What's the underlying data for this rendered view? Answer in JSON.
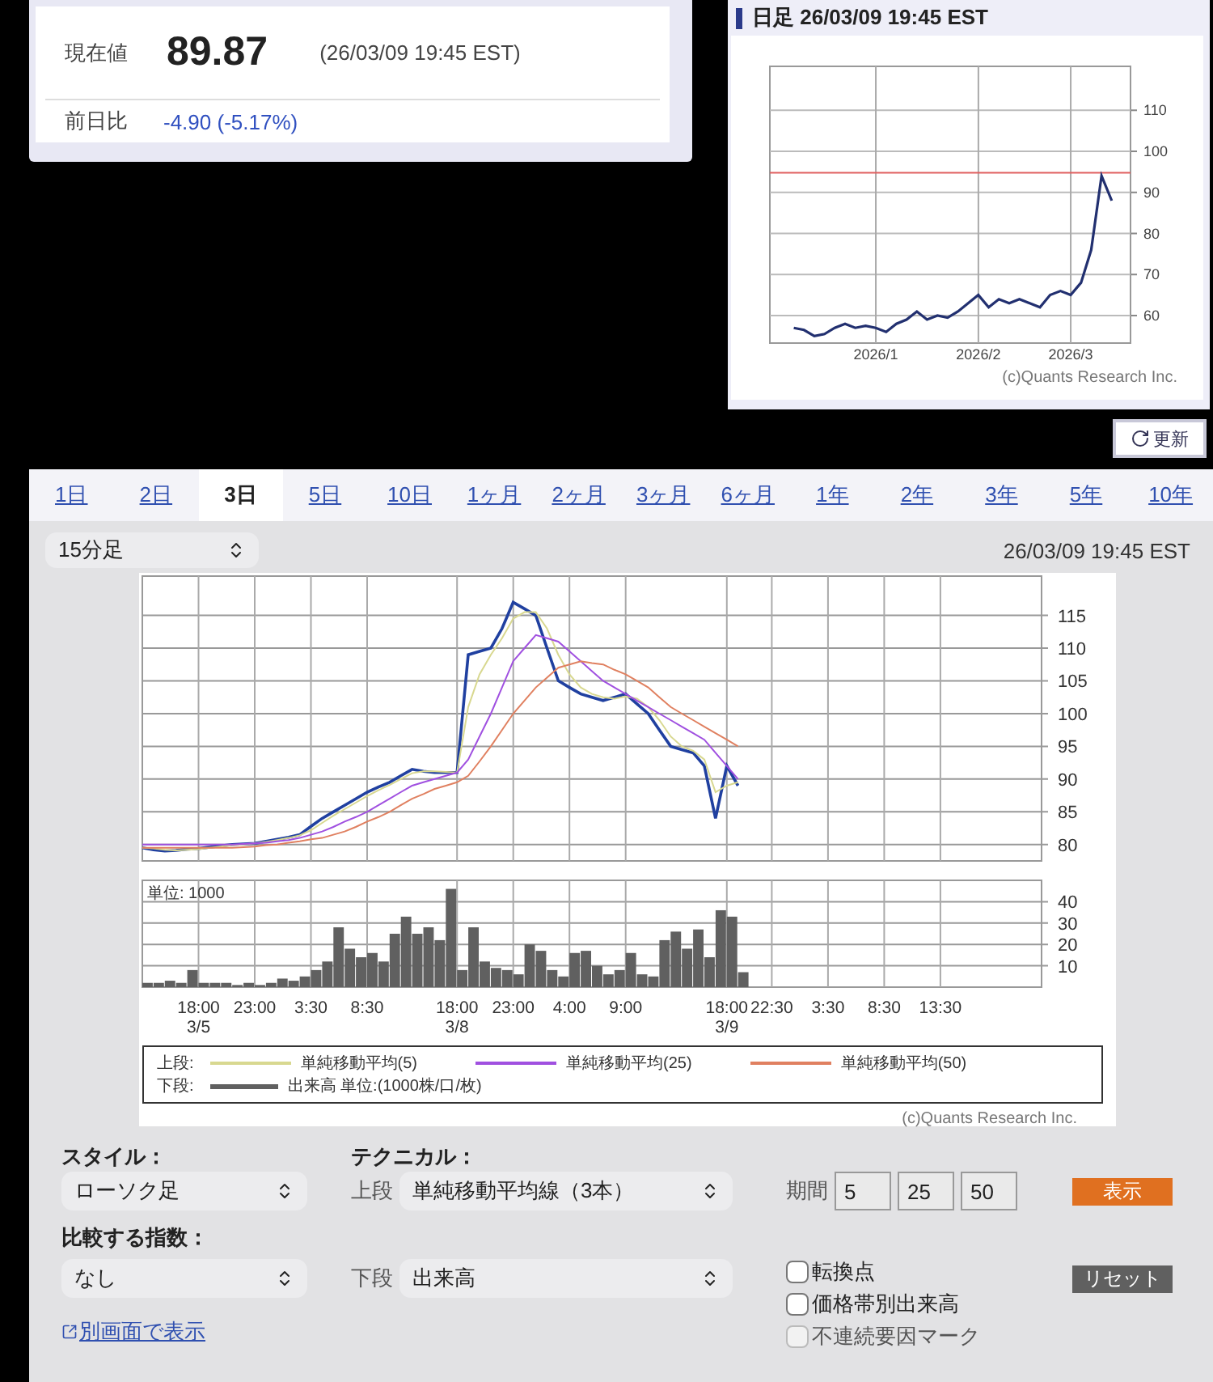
{
  "quote": {
    "current_label": "現在値",
    "price": "89.87",
    "timestamp": "(26/03/09 19:45 EST)",
    "change_label": "前日比",
    "change": "-4.90 (-5.17%)"
  },
  "daily_chart": {
    "title": "日足 26/03/09 19:45 EST",
    "credit": "(c)Quants Research Inc.",
    "chart_data": {
      "type": "line",
      "grid": true,
      "categories": [
        null,
        null,
        null,
        null,
        null,
        null,
        null,
        null,
        "2026/1",
        null,
        null,
        null,
        null,
        null,
        null,
        null,
        null,
        null,
        "2026/2",
        null,
        null,
        null,
        null,
        null,
        null,
        null,
        null,
        "2026/3",
        null,
        null,
        null,
        null
      ],
      "ylim": [
        53.3,
        120.7
      ],
      "yticks": [
        60,
        70,
        80,
        90,
        100,
        110
      ],
      "series": [
        {
          "color": "#223070",
          "values": [
            57,
            56.5,
            55,
            55.5,
            57,
            58,
            57,
            57.5,
            57,
            56,
            58,
            59,
            61,
            59,
            60,
            59.5,
            61,
            63,
            65,
            62,
            64,
            63,
            64,
            63,
            62,
            65,
            66,
            65,
            68,
            76,
            94,
            88
          ]
        }
      ],
      "ref_lines": [
        {
          "axis": "y",
          "value": 94.77
        }
      ]
    }
  },
  "refresh_button": "更新",
  "tabs": [
    {
      "label": "1日",
      "selected": false
    },
    {
      "label": "2日",
      "selected": false
    },
    {
      "label": "3日",
      "selected": true
    },
    {
      "label": "5日",
      "selected": false
    },
    {
      "label": "10日",
      "selected": false
    },
    {
      "label": "1ヶ月",
      "selected": false
    },
    {
      "label": "2ヶ月",
      "selected": false
    },
    {
      "label": "3ヶ月",
      "selected": false
    },
    {
      "label": "6ヶ月",
      "selected": false
    },
    {
      "label": "1年",
      "selected": false
    },
    {
      "label": "2年",
      "selected": false
    },
    {
      "label": "3年",
      "selected": false
    },
    {
      "label": "5年",
      "selected": false
    },
    {
      "label": "10年",
      "selected": false
    }
  ],
  "interval_select": "15分足",
  "chart_timestamp": "26/03/09 19:45 EST",
  "price_chart": {
    "chart_data": {
      "type": "line",
      "grid": true,
      "categories": [
        null,
        null,
        null,
        null,
        null,
        null,
        null,
        null,
        null,
        null,
        null,
        null,
        null,
        null,
        null,
        null,
        null,
        null,
        null,
        null,
        null,
        null,
        null,
        null,
        null,
        null,
        null,
        null,
        null,
        null,
        null,
        null,
        null,
        null,
        null,
        null,
        null,
        null,
        null,
        null,
        null,
        null,
        null,
        null,
        null,
        null,
        null,
        null,
        null,
        null,
        null,
        null,
        null,
        null,
        null,
        null,
        null,
        null,
        null,
        null,
        null,
        null,
        null,
        null,
        null,
        null,
        null,
        null,
        null,
        null,
        null,
        null,
        null,
        null,
        null,
        null,
        null,
        null,
        null,
        null
      ],
      "ylim": [
        77.5,
        121
      ],
      "yticks": [
        80,
        85,
        90,
        95,
        100,
        105,
        110,
        115
      ],
      "series": [
        {
          "color": "#2040a0",
          "values": [
            79.5,
            79.2,
            79,
            79.1,
            79.3,
            79.4,
            79.6,
            79.8,
            80,
            80.1,
            80.2,
            80.5,
            80.8,
            81.1,
            81.5,
            82.8,
            84,
            85,
            86,
            87,
            88,
            88.8,
            89.5,
            90.5,
            91.5,
            91.2,
            91,
            91,
            91,
            109,
            109.5,
            110,
            113,
            117,
            116,
            115,
            110,
            105,
            104,
            103,
            102.5,
            102,
            102.5,
            103,
            101.5,
            100,
            97.5,
            95,
            94.5,
            94,
            92,
            84,
            92,
            89,
            null,
            null,
            null,
            null,
            null,
            null,
            null,
            null,
            null,
            null,
            null,
            null,
            null,
            null,
            null,
            null,
            null,
            null,
            null,
            null,
            null,
            null,
            null,
            null,
            null,
            null
          ]
        },
        {
          "name": "単純移動平均(5)",
          "color": "#d8d890",
          "values": [
            79.5,
            79.4,
            79.2,
            79.1,
            79.2,
            79.3,
            79.5,
            79.7,
            79.9,
            80,
            80.2,
            80.4,
            80.7,
            81,
            81.4,
            82.2,
            83.3,
            84.4,
            85.4,
            86.4,
            87.4,
            88.3,
            89.1,
            90,
            90.9,
            91.2,
            91.2,
            91.1,
            91,
            101,
            106,
            109,
            111.5,
            114.5,
            115.5,
            115.5,
            113,
            109,
            106,
            104,
            103,
            102.5,
            102.3,
            102.6,
            102.3,
            101,
            99,
            96.5,
            95,
            94.3,
            93,
            88,
            89,
            89.5,
            null,
            null,
            null,
            null,
            null,
            null,
            null,
            null,
            null,
            null,
            null,
            null,
            null,
            null,
            null,
            null,
            null,
            null,
            null,
            null,
            null,
            null,
            null,
            null,
            null,
            null
          ]
        },
        {
          "name": "単純移動平均(25)",
          "color": "#a050e0",
          "values": [
            80,
            80,
            80,
            80,
            80,
            80,
            80,
            80,
            80,
            80.1,
            80.2,
            80.3,
            80.5,
            80.7,
            81,
            81.5,
            82,
            82.7,
            83.5,
            84.2,
            85,
            86,
            87,
            88,
            89,
            89.5,
            90,
            90.5,
            91,
            93,
            96.5,
            100,
            104,
            108,
            110,
            112,
            111.5,
            111,
            109.5,
            108,
            106.5,
            105,
            104,
            103,
            102,
            101,
            100,
            99,
            98,
            97,
            96,
            94,
            92,
            90,
            null,
            null,
            null,
            null,
            null,
            null,
            null,
            null,
            null,
            null,
            null,
            null,
            null,
            null,
            null,
            null,
            null,
            null,
            null,
            null,
            null,
            null,
            null,
            null,
            null,
            null
          ]
        },
        {
          "name": "単純移動平均(50)",
          "color": "#e08060",
          "values": [
            79.5,
            79.5,
            79.5,
            79.5,
            79.5,
            79.5,
            79.5,
            79.5,
            79.5,
            79.6,
            79.7,
            79.9,
            80,
            80.3,
            80.5,
            80.8,
            81,
            81.5,
            82,
            82.7,
            83.5,
            84.2,
            85,
            86,
            87,
            87.7,
            88.5,
            89,
            89.5,
            90.5,
            92.7,
            95,
            97.5,
            100,
            102,
            104,
            105.5,
            107,
            107.5,
            108,
            107.7,
            107.5,
            106.7,
            106,
            105,
            104,
            102.5,
            101,
            100,
            99,
            98,
            97,
            96,
            95,
            null,
            null,
            null,
            null,
            null,
            null,
            null,
            null,
            null,
            null,
            null,
            null,
            null,
            null,
            null,
            null,
            null,
            null,
            null,
            null,
            null,
            null,
            null,
            null,
            null,
            null
          ]
        }
      ]
    },
    "legend_label": "上段:"
  },
  "volume_chart": {
    "chart_data": {
      "type": "bar",
      "grid": true,
      "ylabel": "単位: 1000",
      "categories": [
        null,
        null,
        null,
        null,
        null,
        "18:00\n3/5",
        null,
        null,
        null,
        null,
        "23:00",
        null,
        null,
        null,
        null,
        "3:30",
        null,
        null,
        null,
        null,
        "8:30",
        null,
        null,
        null,
        null,
        null,
        null,
        null,
        "18:00\n3/8",
        null,
        null,
        null,
        null,
        "23:00",
        null,
        null,
        null,
        null,
        "4:00",
        null,
        null,
        null,
        null,
        "9:00",
        null,
        null,
        null,
        null,
        null,
        null,
        null,
        null,
        "18:00\n3/9",
        null,
        null,
        null,
        "22:30",
        null,
        null,
        null,
        null,
        "3:30",
        null,
        null,
        null,
        null,
        "8:30",
        null,
        null,
        null,
        null,
        "13:30",
        null,
        null,
        null,
        null,
        null,
        null,
        null,
        null
      ],
      "ylim": [
        0,
        50
      ],
      "yticks": [
        10,
        20,
        30,
        40
      ],
      "series": [
        {
          "name": "出来高 単位:(1000株/口/枚)",
          "color": "#606060",
          "values": [
            2,
            2,
            3,
            2,
            8,
            2,
            2,
            2,
            1,
            2,
            1,
            2,
            4,
            3,
            5,
            8,
            12,
            28,
            18,
            14,
            16,
            12,
            25,
            33,
            25,
            28,
            22,
            46,
            8,
            28,
            12,
            9,
            8,
            6,
            20,
            17,
            8,
            5,
            16,
            17,
            10,
            6,
            8,
            16,
            6,
            5,
            22,
            26,
            18,
            27,
            14,
            36,
            33,
            7,
            null,
            null,
            null,
            null,
            null,
            null,
            null,
            null,
            null,
            null,
            null,
            null,
            null,
            null,
            null,
            null,
            null,
            null,
            null,
            null,
            null,
            null,
            null,
            null,
            null,
            null
          ]
        }
      ]
    },
    "legend_label": "下段:"
  },
  "credit": "(c)Quants Research Inc.",
  "controls": {
    "style_label": "スタイル：",
    "style_select": "ローソク足",
    "technical_label": "テクニカル：",
    "upper_label": "上段",
    "upper_select": "単純移動平均線（3本）",
    "period_label": "期間",
    "periods": [
      "5",
      "25",
      "50"
    ],
    "show_button": "表示",
    "compare_label": "比較する指数：",
    "compare_select": "なし",
    "lower_label": "下段",
    "lower_select": "出来高",
    "checkboxes": [
      {
        "label": "転換点",
        "checked": false,
        "disabled": false
      },
      {
        "label": "価格帯別出来高",
        "checked": false,
        "disabled": false
      },
      {
        "label": "不連続要因マーク",
        "checked": false,
        "disabled": true
      }
    ],
    "reset_button": "リセット",
    "popup_link": "別画面で表示"
  }
}
